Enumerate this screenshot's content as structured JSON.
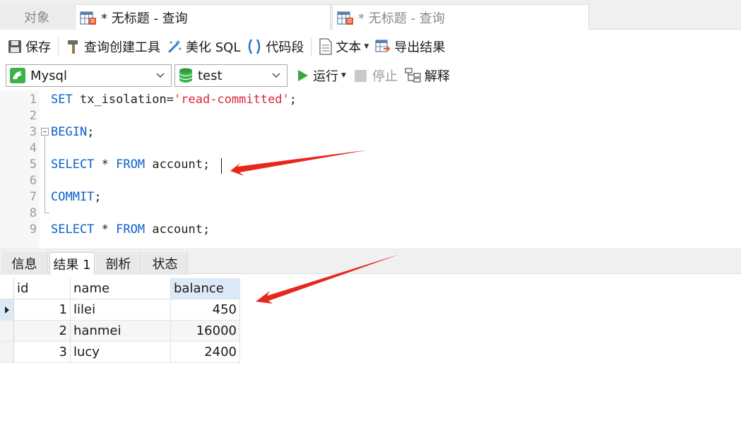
{
  "tabs": {
    "objects": "对象",
    "active_query": "* 无标题 - 查询",
    "inactive_query": "* 无标题 - 查询"
  },
  "toolbar": {
    "save": "保存",
    "query_builder": "查询创建工具",
    "beautify": "美化 SQL",
    "snippet": "代码段",
    "text": "文本",
    "export": "导出结果"
  },
  "connection": {
    "server": "Mysql",
    "database": "test",
    "run": "运行",
    "stop": "停止",
    "explain": "解释"
  },
  "editor": {
    "lines": [
      {
        "num": "1",
        "tokens": [
          {
            "t": "SET",
            "c": "kw"
          },
          {
            "t": " tx_isolation=",
            "c": "plain"
          },
          {
            "t": "'read-committed'",
            "c": "str"
          },
          {
            "t": ";",
            "c": "plain"
          }
        ]
      },
      {
        "num": "2",
        "tokens": []
      },
      {
        "num": "3",
        "tokens": [
          {
            "t": "BEGIN",
            "c": "kw"
          },
          {
            "t": ";",
            "c": "plain"
          }
        ]
      },
      {
        "num": "4",
        "tokens": []
      },
      {
        "num": "5",
        "tokens": [
          {
            "t": "SELECT",
            "c": "kw"
          },
          {
            "t": " * ",
            "c": "plain"
          },
          {
            "t": "FROM",
            "c": "kw"
          },
          {
            "t": " account;",
            "c": "plain"
          }
        ]
      },
      {
        "num": "6",
        "tokens": []
      },
      {
        "num": "7",
        "tokens": [
          {
            "t": "COMMIT",
            "c": "kw"
          },
          {
            "t": ";",
            "c": "plain"
          }
        ]
      },
      {
        "num": "8",
        "tokens": []
      },
      {
        "num": "9",
        "tokens": [
          {
            "t": "SELECT",
            "c": "kw"
          },
          {
            "t": " * ",
            "c": "plain"
          },
          {
            "t": "FROM",
            "c": "kw"
          },
          {
            "t": " account;",
            "c": "plain"
          }
        ]
      }
    ]
  },
  "result_tabs": [
    "信息",
    "结果 1",
    "剖析",
    "状态"
  ],
  "grid": {
    "columns": [
      "id",
      "name",
      "balance"
    ],
    "rows": [
      [
        "1",
        "lilei",
        "450"
      ],
      [
        "2",
        "hanmei",
        "16000"
      ],
      [
        "3",
        "lucy",
        "2400"
      ]
    ]
  },
  "colors": {
    "keyword": "#0a62c9",
    "string": "#d6283a",
    "annotation_arrow": "#e8261c",
    "run_green": "#3aa83a"
  }
}
